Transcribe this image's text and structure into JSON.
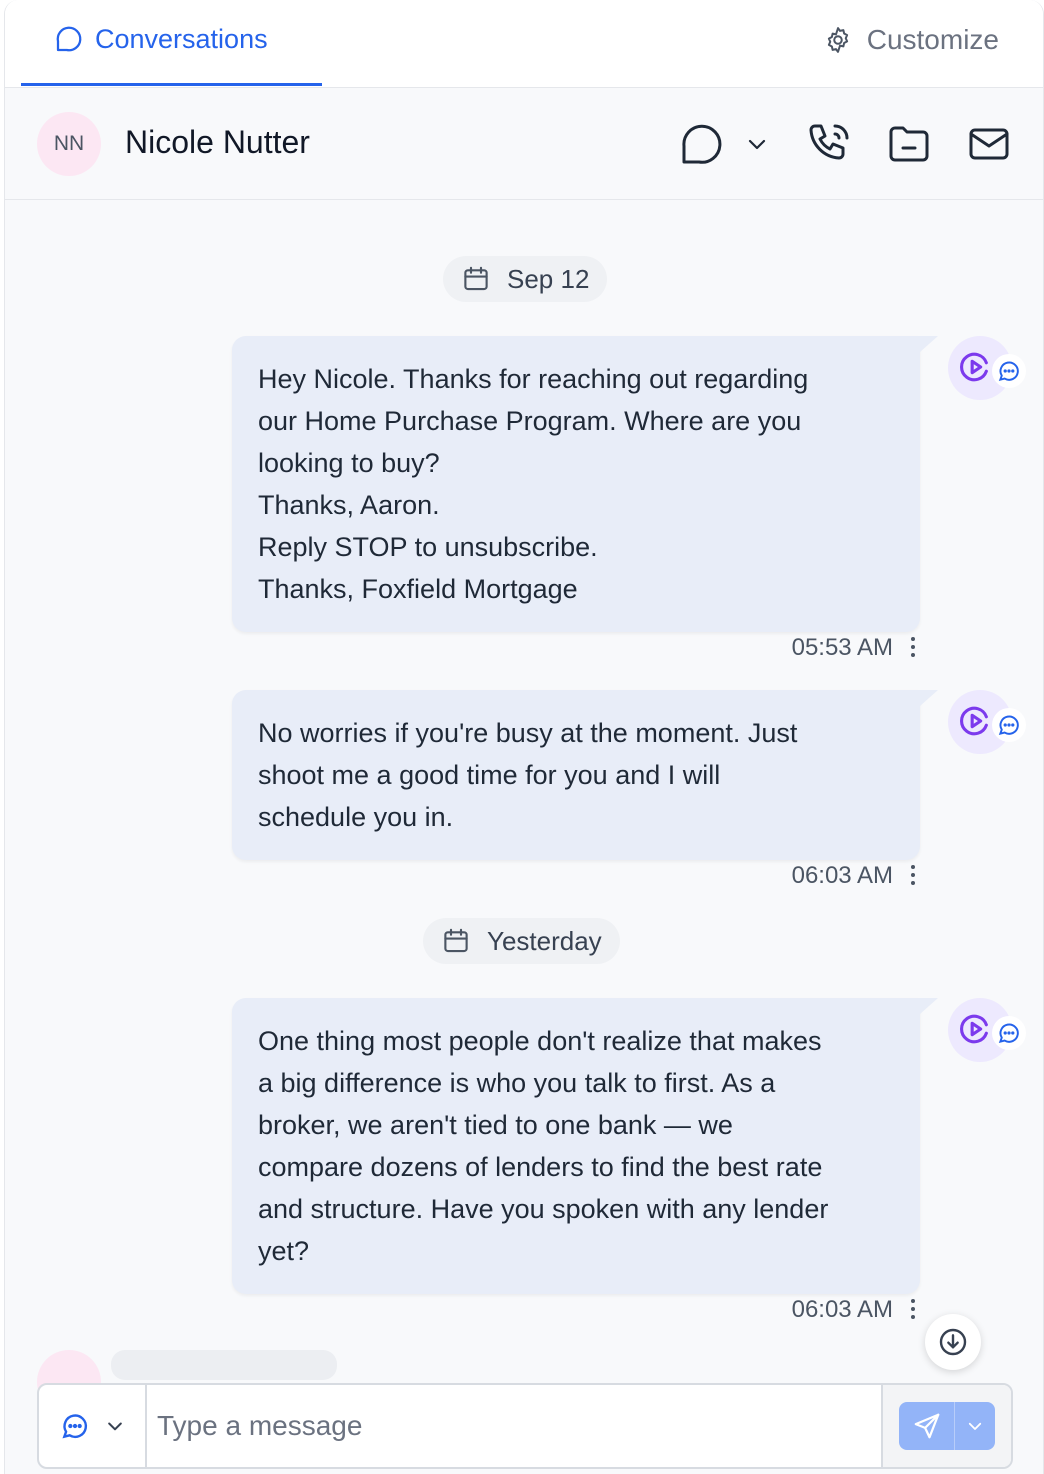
{
  "tabs": {
    "conversations_label": "Conversations",
    "customize_label": "Customize"
  },
  "contact": {
    "initials": "NN",
    "name": "Nicole Nutter"
  },
  "header_icons": [
    "chat-bubble-icon",
    "chevron-down-icon",
    "phone-icon",
    "folder-icon",
    "mail-icon"
  ],
  "dates": {
    "first": "Sep 12",
    "second": "Yesterday"
  },
  "messages": [
    {
      "lines": [
        "Hey Nicole. Thanks for reaching out regarding",
        "our Home Purchase Program. Where are you",
        "looking to buy?",
        "Thanks, Aaron.",
        "Reply STOP to unsubscribe.",
        "Thanks, Foxfield Mortgage"
      ],
      "time": "05:53 AM"
    },
    {
      "lines": [
        "No worries if you're busy at the moment. Just",
        "shoot me a good time for you and I will",
        "schedule you in."
      ],
      "time": "06:03 AM"
    },
    {
      "lines": [
        "One thing most people don't realize that makes",
        "a big difference is who you talk to first. As a",
        "broker, we aren't tied to one bank — we",
        "compare dozens of lenders to find the best rate",
        "and structure. Have you spoken with any lender",
        "yet?"
      ],
      "time": "06:03 AM"
    }
  ],
  "composer": {
    "placeholder": "Type a message"
  },
  "colors": {
    "accent": "#2563eb",
    "bubble": "#e8edf8",
    "avatar_bg": "#fce7f3",
    "send_button": "#93b4f8"
  }
}
